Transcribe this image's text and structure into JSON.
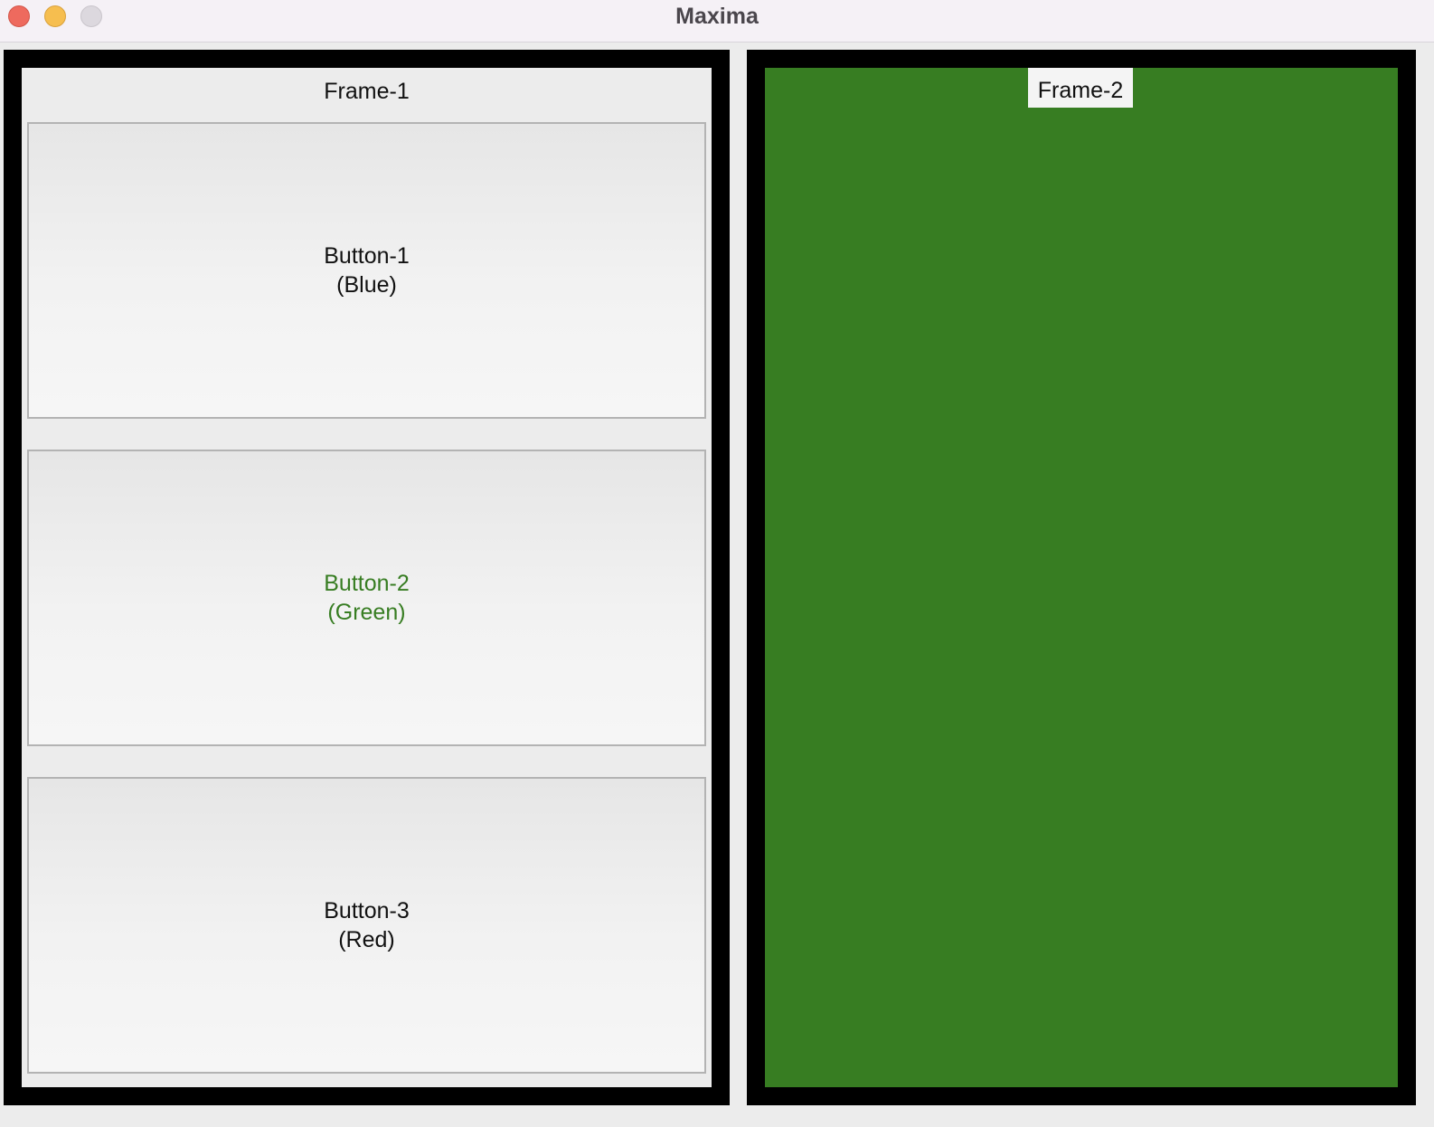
{
  "window": {
    "title": "Maxima"
  },
  "frame1": {
    "label": "Frame-1",
    "buttons": [
      {
        "line1": "Button-1",
        "line2": "(Blue)",
        "text_color": "#111111"
      },
      {
        "line1": "Button-2",
        "line2": "(Green)",
        "text_color": "#377d22"
      },
      {
        "line1": "Button-3",
        "line2": "(Red)",
        "text_color": "#111111"
      }
    ]
  },
  "frame2": {
    "label": "Frame-2",
    "background_color": "#377d22"
  },
  "colors": {
    "frame_border": "#000000",
    "accent_green": "#377d22"
  }
}
